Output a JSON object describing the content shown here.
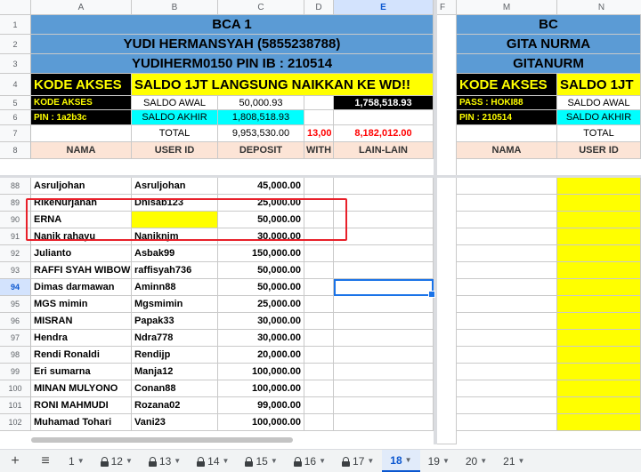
{
  "columns": [
    "A",
    "B",
    "C",
    "D",
    "E",
    "F",
    "M",
    "N"
  ],
  "header_rows": [
    "1",
    "2",
    "3",
    "4",
    "5",
    "6",
    "7",
    "8"
  ],
  "left": {
    "title": "BCA 1",
    "name": "YUDI HERMANSYAH (5855238788)",
    "pin_line": "YUDIHERM0150 PIN IB : 210514",
    "kode_akses": "KODE AKSES",
    "banner": "SALDO 1JT LANGSUNG NAIKKAN KE WD!!",
    "kode_akses_small": "KODE AKSES",
    "saldo_awal_label": "SALDO AWAL",
    "saldo_awal": "50,000.93",
    "e5": "1,758,518.93",
    "pin": "PIN : 1a2b3c",
    "saldo_akhir_label": "SALDO AKHIR",
    "saldo_akhir": "1,808,518.93",
    "total_label": "TOTAL",
    "total_deposit": "9,953,530.00",
    "total_with": "13,00",
    "total_lain": "8,182,012.00",
    "col_nama": "NAMA",
    "col_userid": "USER ID",
    "col_deposit": "DEPOSIT",
    "col_with": "WITH",
    "col_lain": "LAIN-LAIN"
  },
  "right": {
    "title": "BC",
    "name": "GITA NURMA",
    "pin_line": "GITANURM",
    "kode_akses": "KODE AKSES",
    "banner": "SALDO 1JT",
    "pass": "PASS : HOKI88",
    "saldo_awal_label": "SALDO AWAL",
    "pin": "PIN : 210514",
    "saldo_akhir_label": "SALDO AKHIR",
    "total_label": "TOTAL",
    "col_nama": "NAMA",
    "col_userid": "USER ID"
  },
  "rows": [
    {
      "num": "88",
      "nama": "Asruljohan",
      "userid": "Asruljohan",
      "deposit": "45,000.00"
    },
    {
      "num": "89",
      "nama": "RikeNurjanah",
      "userid": "Dnisab123",
      "deposit": "25,000.00"
    },
    {
      "num": "90",
      "nama": "ERNA",
      "userid": "",
      "deposit": "50,000.00"
    },
    {
      "num": "91",
      "nama": "Nanik rahayu",
      "userid": "Naniknjm",
      "deposit": "30,000.00"
    },
    {
      "num": "92",
      "nama": "Julianto",
      "userid": "Asbak99",
      "deposit": "150,000.00"
    },
    {
      "num": "93",
      "nama": "RAFFI SYAH WIBOWO",
      "userid": "raffisyah736",
      "deposit": "50,000.00"
    },
    {
      "num": "94",
      "nama": "Dimas darmawan",
      "userid": "Aminn88",
      "deposit": "50,000.00"
    },
    {
      "num": "95",
      "nama": "MGS mimin",
      "userid": "Mgsmimin",
      "deposit": "25,000.00"
    },
    {
      "num": "96",
      "nama": "MISRAN",
      "userid": "Papak33",
      "deposit": "30,000.00"
    },
    {
      "num": "97",
      "nama": "Hendra",
      "userid": "Ndra778",
      "deposit": "30,000.00"
    },
    {
      "num": "98",
      "nama": "Rendi Ronaldi",
      "userid": "Rendijp",
      "deposit": "20,000.00"
    },
    {
      "num": "99",
      "nama": "Eri sumarna",
      "userid": "Manja12",
      "deposit": "100,000.00"
    },
    {
      "num": "100",
      "nama": "MINAN MULYONO",
      "userid": "Conan88",
      "deposit": "100,000.00"
    },
    {
      "num": "101",
      "nama": "RONI MAHMUDI",
      "userid": "Rozana02",
      "deposit": "99,000.00"
    },
    {
      "num": "102",
      "nama": "Muhamad Tohari",
      "userid": "Vani23",
      "deposit": "100,000.00"
    }
  ],
  "sheet_tabs": [
    {
      "label": "1",
      "locked": false
    },
    {
      "label": "12",
      "locked": true
    },
    {
      "label": "13",
      "locked": true
    },
    {
      "label": "14",
      "locked": true
    },
    {
      "label": "15",
      "locked": true
    },
    {
      "label": "16",
      "locked": true
    },
    {
      "label": "17",
      "locked": true
    },
    {
      "label": "18",
      "locked": false,
      "active": true
    },
    {
      "label": "19",
      "locked": false
    },
    {
      "label": "20",
      "locked": false
    },
    {
      "label": "21",
      "locked": false
    }
  ],
  "tab_add": "+",
  "tab_menu": "≡"
}
